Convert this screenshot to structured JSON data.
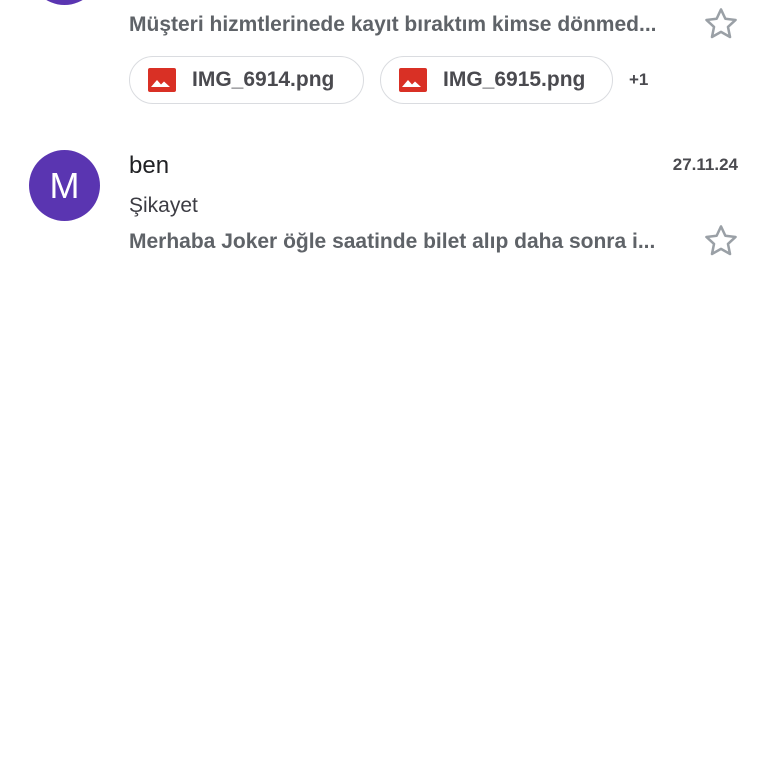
{
  "messages": [
    {
      "avatar_letter": "",
      "sender": "",
      "date": "",
      "subject": "",
      "snippet": "Müşteri hizmtlerinede kayıt bıraktım kimse dönmed...",
      "attachments": [
        {
          "name": "IMG_6914.png"
        },
        {
          "name": "IMG_6915.png"
        }
      ],
      "more_attachments": "+1",
      "starred": false
    },
    {
      "avatar_letter": "M",
      "sender": "ben",
      "date": "27.11.24",
      "subject": "Şikayet",
      "snippet": "Merhaba Joker öğle saatinde bilet alıp daha sonra i...",
      "starred": false
    }
  ],
  "colors": {
    "avatar": "#5a35b1",
    "image_icon": "#d93025",
    "star_outline": "#9aa0a6"
  }
}
